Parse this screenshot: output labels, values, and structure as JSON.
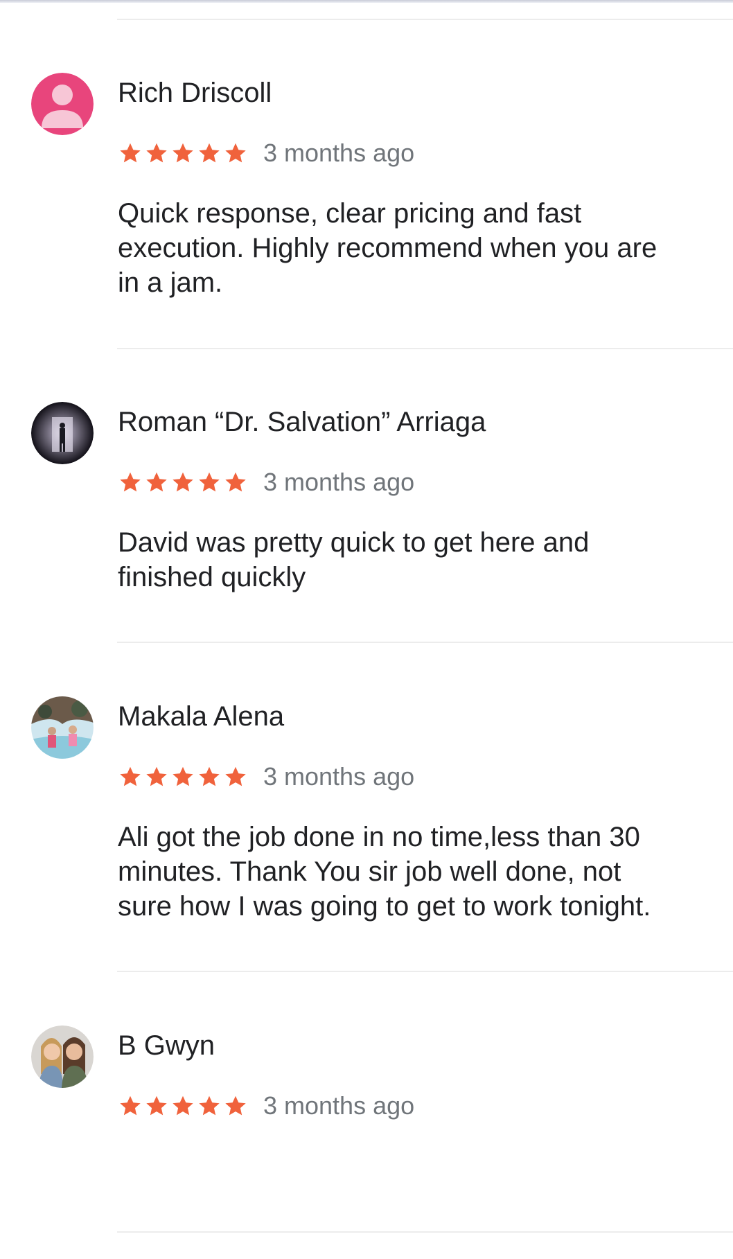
{
  "theme": {
    "star_color": "#f0623c",
    "text_color": "#202124",
    "muted_color": "#70757a",
    "divider_color": "#ececec"
  },
  "reviews": [
    {
      "name": "Rich Driscoll",
      "rating": 5,
      "time": "3 months ago",
      "text": "Quick response, clear pricing and fast\nexecution.  Highly recommend when you are\nin a jam.",
      "avatar": "default-person-icon"
    },
    {
      "name": "Roman “Dr. Salvation” Arriaga",
      "rating": 5,
      "time": "3 months ago",
      "text": "David was pretty quick to get here and\nfinished quickly",
      "avatar": "tunnel-silhouette-photo"
    },
    {
      "name": "Makala Alena",
      "rating": 5,
      "time": "3 months ago",
      "text": "Ali got the job done in no time,less than 30\nminutes. Thank You sir job well done, not\nsure how I was going to get to work tonight.",
      "avatar": "water-play-photo"
    },
    {
      "name": "B Gwyn",
      "rating": 5,
      "time": "3 months ago",
      "text": "",
      "avatar": "two-people-photo"
    }
  ]
}
